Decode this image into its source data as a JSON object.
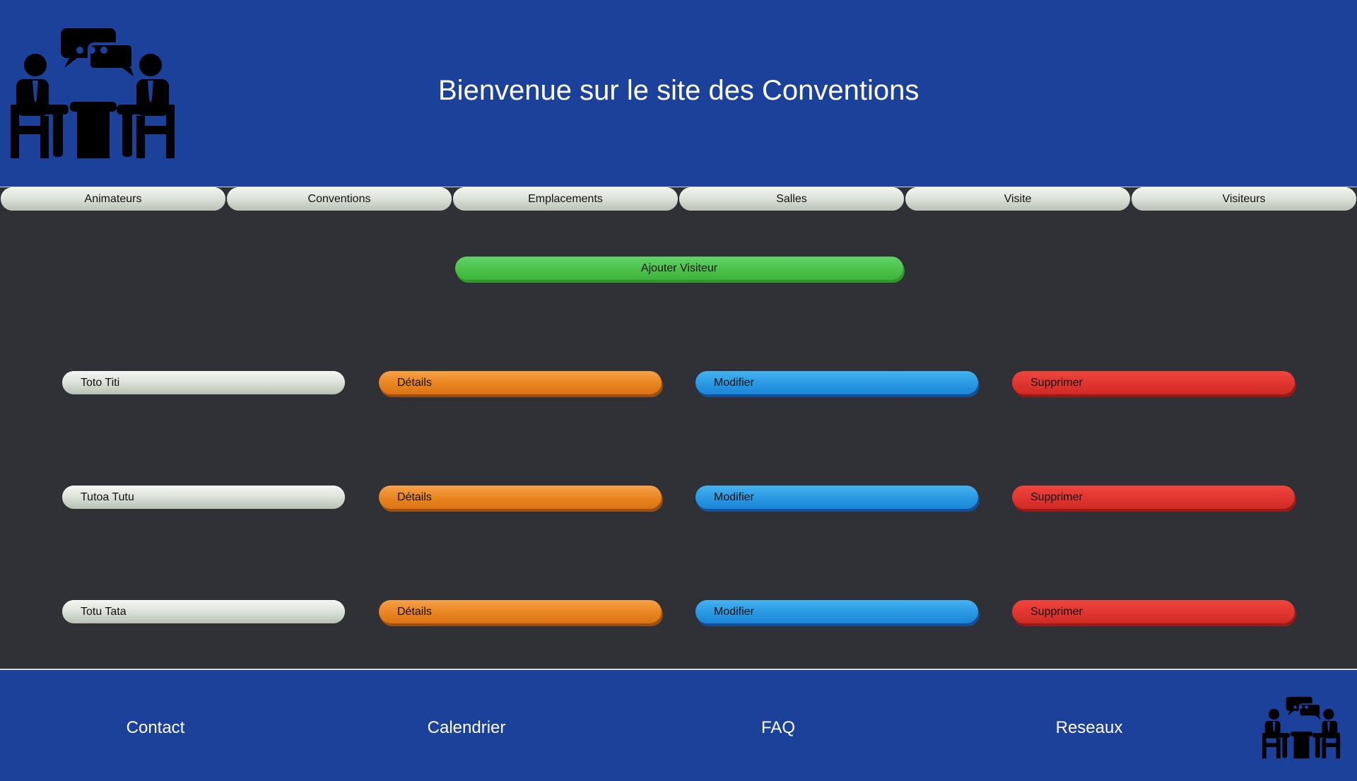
{
  "header": {
    "title": "Bienvenue sur le site des Conventions",
    "logo_icon": "meeting-icon"
  },
  "nav": {
    "items": [
      {
        "label": "Animateurs"
      },
      {
        "label": "Conventions"
      },
      {
        "label": "Emplacements"
      },
      {
        "label": "Salles"
      },
      {
        "label": "Visite"
      },
      {
        "label": "Visiteurs"
      }
    ]
  },
  "main": {
    "add_label": "Ajouter Visiteur",
    "rows": [
      {
        "name": "Toto Titi",
        "details_label": "Détails",
        "modify_label": "Modifier",
        "delete_label": "Supprimer"
      },
      {
        "name": "Tutoa Tutu",
        "details_label": "Détails",
        "modify_label": "Modifier",
        "delete_label": "Supprimer"
      },
      {
        "name": "Totu Tata",
        "details_label": "Détails",
        "modify_label": "Modifier",
        "delete_label": "Supprimer"
      }
    ]
  },
  "footer": {
    "links": [
      {
        "label": "Contact"
      },
      {
        "label": "Calendrier"
      },
      {
        "label": "FAQ"
      },
      {
        "label": "Reseaux"
      }
    ],
    "logo_icon": "meeting-icon"
  },
  "colors": {
    "header_bg": "#1c419a",
    "page_bg": "#303136",
    "add": "#4cc24b",
    "details": "#e8841f",
    "modify": "#2a98e2",
    "delete": "#e03530"
  }
}
